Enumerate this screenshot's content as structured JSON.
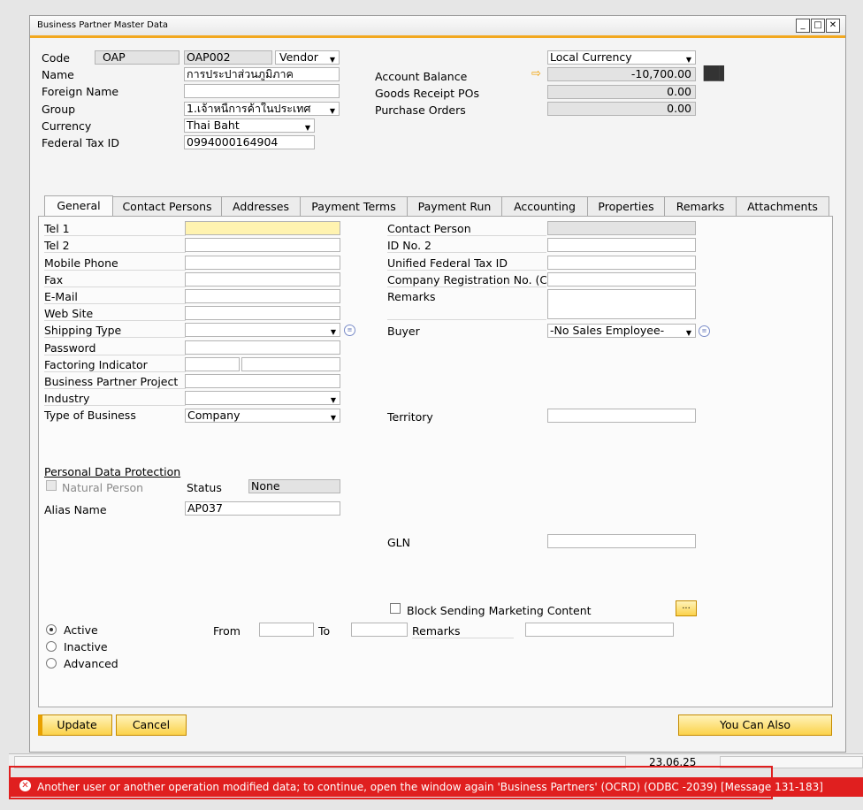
{
  "window": {
    "title": "Business Partner Master Data"
  },
  "header": {
    "code_label": "Code",
    "code_series": "OAP",
    "code_value": "OAP002",
    "bp_type": "Vendor",
    "name_label": "Name",
    "name_value": "การประปาส่วนภูมิภาค",
    "foreign_name_label": "Foreign Name",
    "foreign_name_value": "",
    "group_label": "Group",
    "group_value": "1.เจ้าหนี้การค้าในประเทศ",
    "currency_label": "Currency",
    "currency_value": "Thai Baht",
    "federal_tax_label": "Federal Tax ID",
    "federal_tax_value": "0994000164904",
    "local_currency": "Local Currency",
    "account_balance_label": "Account Balance",
    "account_balance_value": "-10,700.00",
    "goods_receipt_label": "Goods Receipt POs",
    "goods_receipt_value": "0.00",
    "purchase_orders_label": "Purchase Orders",
    "purchase_orders_value": "0.00"
  },
  "tabs": [
    "General",
    "Contact Persons",
    "Addresses",
    "Payment Terms",
    "Payment Run",
    "Accounting",
    "Properties",
    "Remarks",
    "Attachments"
  ],
  "general": {
    "tel1": "Tel 1",
    "tel2": "Tel 2",
    "mobile": "Mobile Phone",
    "fax": "Fax",
    "email": "E-Mail",
    "website": "Web Site",
    "shipping_type": "Shipping Type",
    "password": "Password",
    "factoring": "Factoring Indicator",
    "bp_project": "Business Partner Project",
    "industry": "Industry",
    "type_of_business": "Type of Business",
    "type_of_business_value": "Company",
    "contact_person": "Contact Person",
    "id_no2": "ID No. 2",
    "unified_tax": "Unified Federal Tax ID",
    "company_reg": "Company Registration No. (CRN",
    "remarks": "Remarks",
    "buyer": "Buyer",
    "buyer_value": "-No Sales Employee-",
    "territory": "Territory",
    "pdp_title": "Personal Data Protection",
    "natural_person": "Natural Person",
    "status_label": "Status",
    "status_value": "None",
    "alias_label": "Alias Name",
    "alias_value": "AP037",
    "gln": "GLN",
    "block_marketing": "Block Sending Marketing Content",
    "more_btn": "...",
    "active": "Active",
    "inactive": "Inactive",
    "advanced": "Advanced",
    "from": "From",
    "to": "To",
    "remarks2": "Remarks"
  },
  "buttons": {
    "update": "Update",
    "cancel": "Cancel",
    "you_can_also": "You Can Also"
  },
  "status": {
    "date": "23.06.25"
  },
  "error": {
    "message": "Another user or another operation modified data; to continue, open the window again  'Business Partners' (OCRD) (ODBC -2039)  [Message 131-183]"
  },
  "colors": {
    "accent": "#f2a81f",
    "error": "#e01f1f",
    "button": "#fbd24a"
  }
}
